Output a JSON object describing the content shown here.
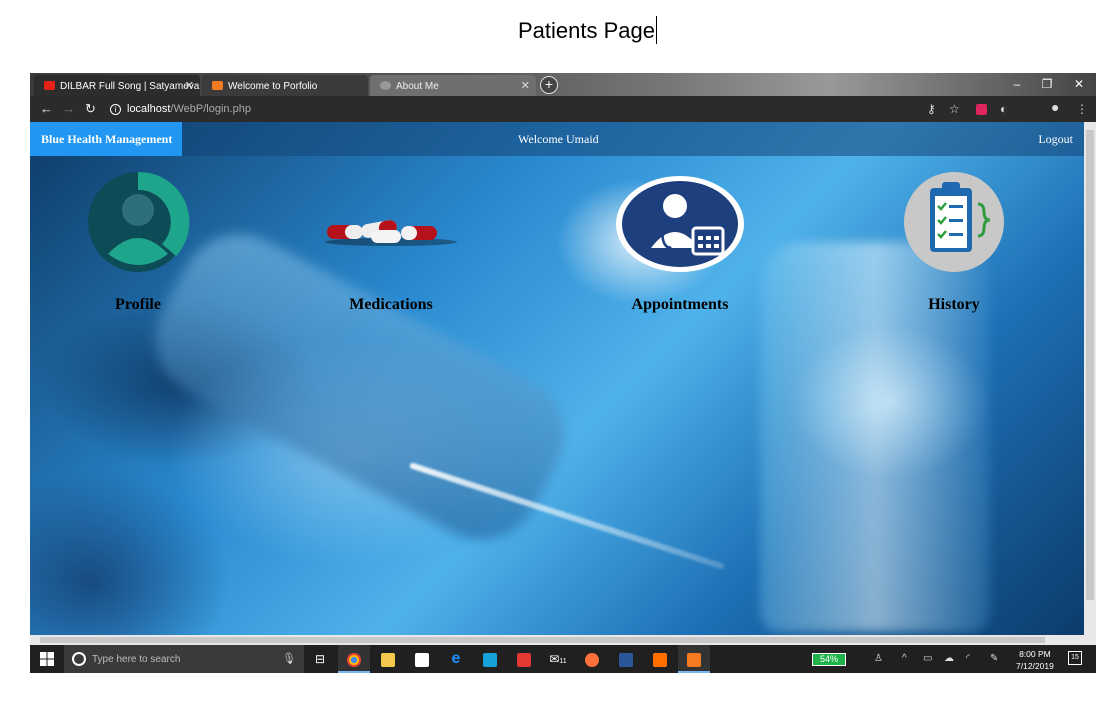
{
  "document": {
    "title": "Patients Page"
  },
  "browser": {
    "tabs": [
      {
        "label": "DILBAR Full Song | Satyameva Ja"
      },
      {
        "label": "Welcome to Porfolio"
      },
      {
        "label": "About Me"
      }
    ],
    "url_host": "localhost",
    "url_path": "/WebP/login.php"
  },
  "app": {
    "brand": "Blue Health Management",
    "welcome": "Welcome Umaid",
    "logout": "Logout",
    "cards": [
      {
        "label": "Profile",
        "icon": "profile-icon"
      },
      {
        "label": "Medications",
        "icon": "pills-icon"
      },
      {
        "label": "Appointments",
        "icon": "doctor-calendar-icon"
      },
      {
        "label": "History",
        "icon": "clipboard-checklist-icon"
      }
    ]
  },
  "taskbar": {
    "search_placeholder": "Type here to search",
    "battery": "54%",
    "time": "8:00 PM",
    "date": "7/12/2019",
    "mail_badge": "11",
    "notification_count": "15"
  }
}
